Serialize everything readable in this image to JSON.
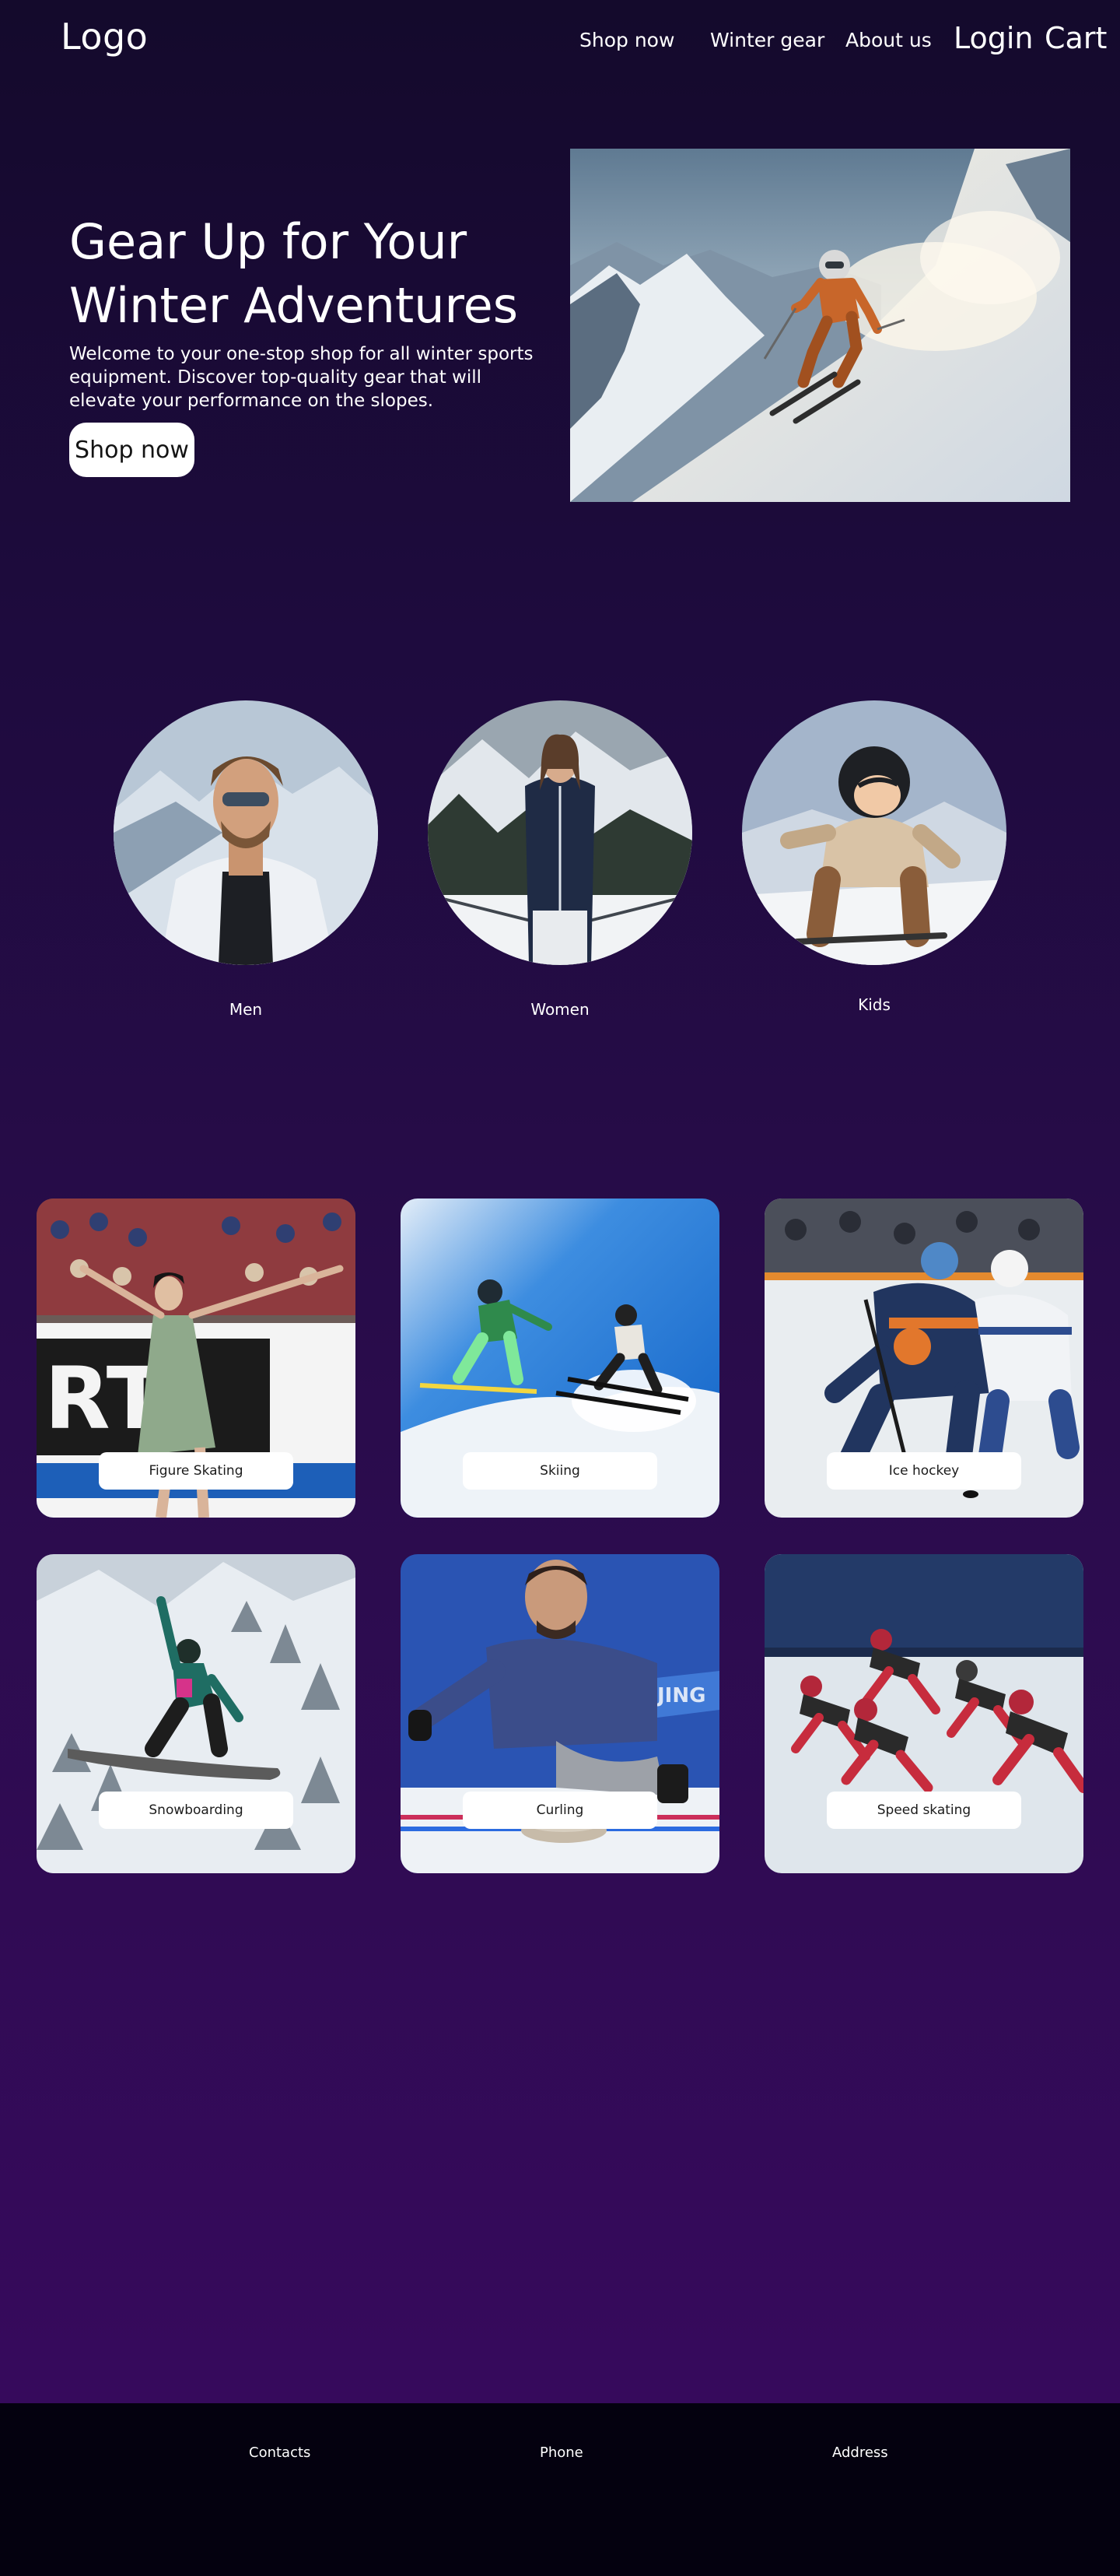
{
  "header": {
    "logo": "Logo",
    "nav": [
      "Shop now",
      "Winter gear",
      "About us"
    ],
    "login": "Login",
    "cart": "Cart"
  },
  "hero": {
    "title": "Gear Up for Your Winter Adventures",
    "description": "Welcome to your one-stop shop for all winter sports equipment. Discover top-quality gear that will elevate your performance on the slopes.",
    "button": "Shop now"
  },
  "categories": [
    "Men",
    "Women",
    "Kids"
  ],
  "sports": [
    "Figure Skating",
    "Skiing",
    "Ice hockey",
    "Snowboarding",
    "Curling",
    "Speed skating"
  ],
  "footer": {
    "links": [
      "Contacts",
      "Phone",
      "Address"
    ]
  },
  "colors": {
    "page_top": "#140a2c",
    "page_bottom": "#360a5c",
    "footer_bg": "#04010f",
    "button_bg": "#ffffff"
  }
}
